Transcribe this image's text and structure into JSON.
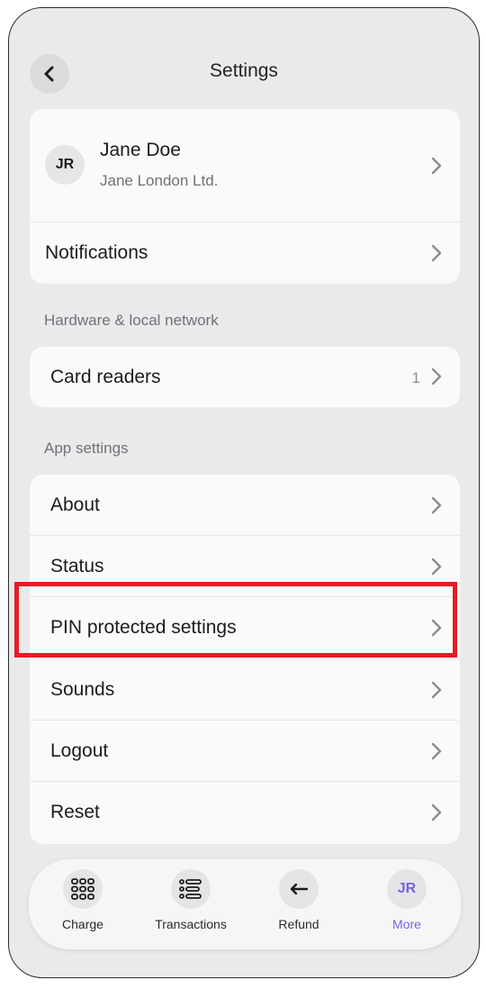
{
  "header": {
    "title": "Settings"
  },
  "profile": {
    "initials": "JR",
    "name": "Jane Doe",
    "company": "Jane London Ltd."
  },
  "account_items": [
    {
      "label": "Notifications"
    }
  ],
  "hardware": {
    "section_label": "Hardware & local network",
    "items": [
      {
        "label": "Card readers",
        "count": "1"
      }
    ]
  },
  "app_settings": {
    "section_label": "App settings",
    "items": [
      {
        "label": "About"
      },
      {
        "label": "Status"
      },
      {
        "label": "PIN protected settings"
      },
      {
        "label": "Sounds"
      },
      {
        "label": "Logout"
      },
      {
        "label": "Reset"
      }
    ]
  },
  "tabbar": {
    "items": [
      {
        "label": "Charge",
        "icon": "keypad-icon"
      },
      {
        "label": "Transactions",
        "icon": "list-icon"
      },
      {
        "label": "Refund",
        "icon": "arrow-left-icon"
      },
      {
        "label": "More",
        "icon": "avatar",
        "initials": "JR",
        "active": true
      }
    ],
    "active_color": "#7b5ee8"
  },
  "highlight_color": "#e51c24"
}
